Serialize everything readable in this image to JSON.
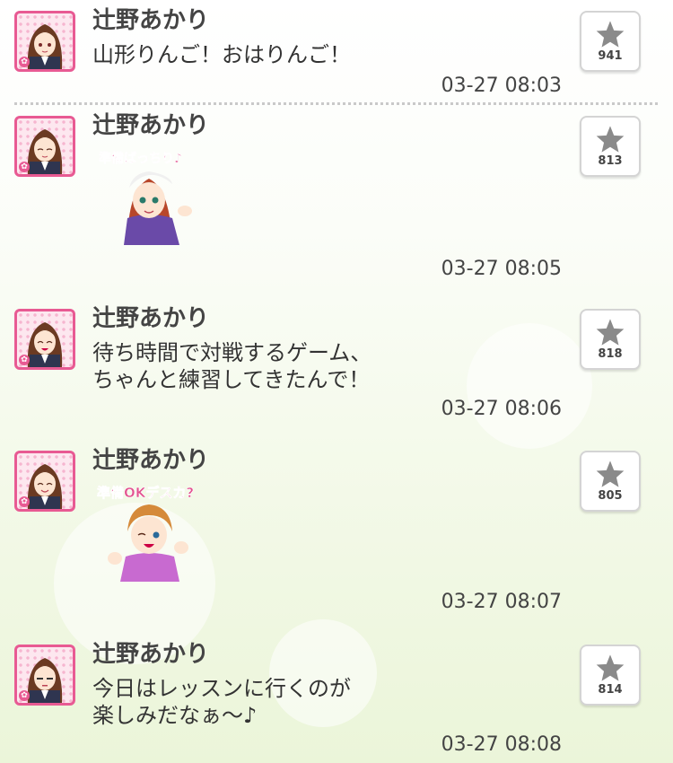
{
  "colors": {
    "accent": "#e85a93",
    "star": "#8a8a8a",
    "text": "#444444"
  },
  "posts": [
    {
      "author": "辻野あかり",
      "lines": [
        "山形りんご！おはりんご！"
      ],
      "time": "03-27 08:03",
      "star_count": "941"
    },
    {
      "author": "辻野あかり",
      "lines": [],
      "sticker": {
        "text": "準備ばっちり♪",
        "icon": "sticker-girl-cap"
      },
      "time": "03-27 08:05",
      "star_count": "813"
    },
    {
      "author": "辻野あかり",
      "lines": [
        "待ち時間で対戦するゲーム、",
        "ちゃんと練習してきたんで！"
      ],
      "time": "03-27 08:06",
      "star_count": "818"
    },
    {
      "author": "辻野あかり",
      "lines": [],
      "sticker": {
        "text": "準備OKデスカ?",
        "icon": "sticker-boy-wink"
      },
      "time": "03-27 08:07",
      "star_count": "805"
    },
    {
      "author": "辻野あかり",
      "lines": [
        "今日はレッスンに行くのが",
        "楽しみだなぁ〜♪"
      ],
      "time": "03-27 08:08",
      "star_count": "814"
    }
  ]
}
